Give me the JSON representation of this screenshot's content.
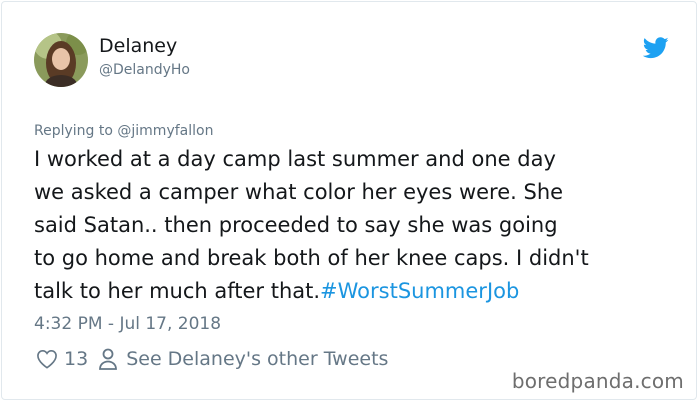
{
  "user": {
    "name": "Delaney",
    "handle": "@DelandyHo"
  },
  "reply": {
    "prefix": "Replying to ",
    "mention": "@jimmyfallon"
  },
  "tweet": {
    "text": "I worked at a day camp last summer and one day\nwe asked a camper what color her eyes were. She\nsaid Satan..  then proceeded to say she was going\nto go home and break both of her knee caps. I didn't\ntalk to her much after that.",
    "hashtag": "#WorstSummerJob"
  },
  "timestamp": "4:32 PM - Jul 17, 2018",
  "actions": {
    "likes": "13",
    "other_tweets": "See Delaney's other Tweets"
  },
  "watermark": "boredpanda.com",
  "colors": {
    "link": "#1b95e0",
    "secondary": "#657786",
    "twitter_blue": "#1da1f2"
  },
  "icons": {
    "brand": "twitter-bird-icon",
    "like": "heart-icon",
    "profile": "person-icon"
  }
}
